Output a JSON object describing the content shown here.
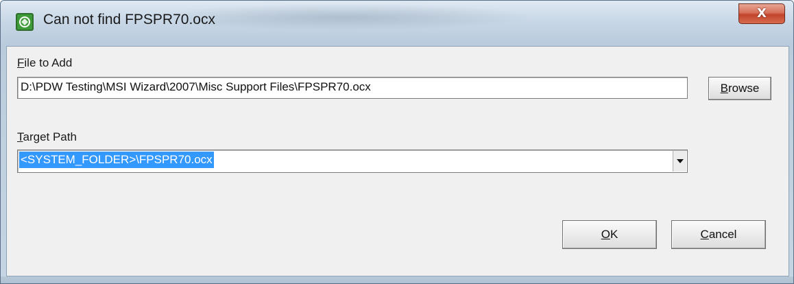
{
  "window": {
    "title": "Can not find FPSPR70.ocx",
    "close_glyph": "X",
    "icon": "app-window-icon"
  },
  "file_to_add": {
    "label_mnemonic": "F",
    "label_rest": "ile to Add",
    "value": "D:\\PDW Testing\\MSI Wizard\\2007\\Misc Support Files\\FPSPR70.ocx"
  },
  "browse_button": {
    "label_mnemonic": "B",
    "label_rest": "rowse"
  },
  "target_path": {
    "label_mnemonic": "T",
    "label_rest": "arget Path",
    "selected_value": "<SYSTEM_FOLDER>\\FPSPR70.ocx",
    "selection_color": "#3399ff"
  },
  "ok_button": {
    "label_mnemonic": "O",
    "label_rest": "K"
  },
  "cancel_button": {
    "label_mnemonic": "C",
    "label_rest": "ancel"
  },
  "colors": {
    "dialog_background": "#f0f0f0",
    "close_button": "#c0452b",
    "title_bar": "#c8d7e6"
  }
}
